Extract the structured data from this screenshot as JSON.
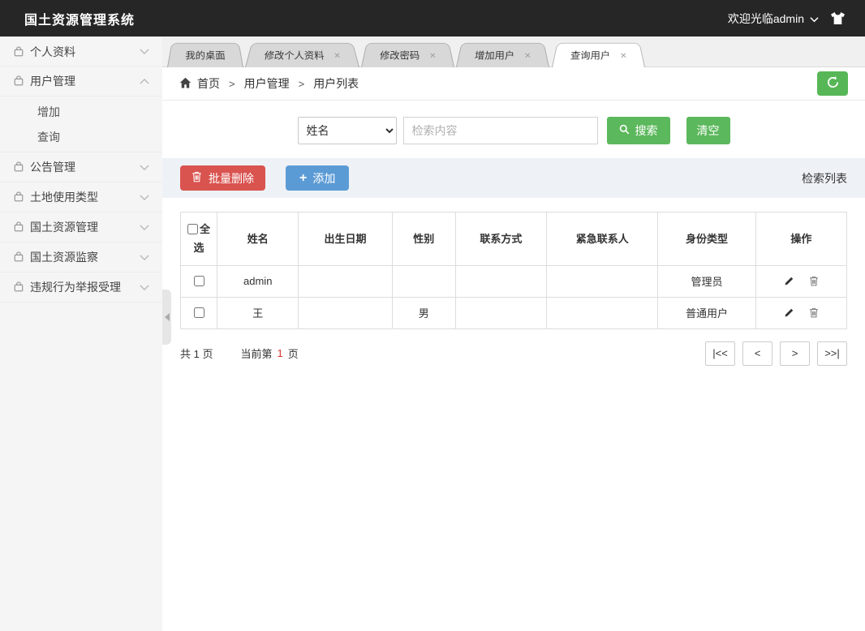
{
  "topbar": {
    "title": "国土资源管理系统",
    "welcome": "欢迎光临admin"
  },
  "icons": {
    "close": "×"
  },
  "sidebar": {
    "items": [
      {
        "label": "个人资料"
      },
      {
        "label": "用户管理",
        "children": [
          {
            "label": "增加"
          },
          {
            "label": "查询"
          }
        ]
      },
      {
        "label": "公告管理"
      },
      {
        "label": "土地使用类型"
      },
      {
        "label": "国土资源管理"
      },
      {
        "label": "国土资源监察"
      },
      {
        "label": "违规行为举报受理"
      }
    ]
  },
  "tabs": [
    {
      "label": "我的桌面",
      "closable": false,
      "active": false
    },
    {
      "label": "修改个人资料",
      "closable": true,
      "active": false
    },
    {
      "label": "修改密码",
      "closable": true,
      "active": false
    },
    {
      "label": "增加用户",
      "closable": true,
      "active": false
    },
    {
      "label": "查询用户",
      "closable": true,
      "active": true
    }
  ],
  "breadcrumb": {
    "home": "首页",
    "sep": ">",
    "level2": "用户管理",
    "level3": "用户列表"
  },
  "search": {
    "field_selected": "姓名",
    "placeholder": "检索内容",
    "search_label": "搜索",
    "clear_label": "清空"
  },
  "toolbar": {
    "batch_delete_label": "批量删除",
    "plus": "+",
    "add_label": "添加",
    "list_label": "检索列表"
  },
  "table": {
    "select_all_label": "全选",
    "headers": [
      "姓名",
      "出生日期",
      "性别",
      "联系方式",
      "紧急联系人",
      "身份类型",
      "操作"
    ],
    "rows": [
      {
        "name": "admin",
        "birth_date": "",
        "gender": "",
        "contact": "",
        "emergency_contact": "",
        "identity_type": "管理员"
      },
      {
        "name": "王",
        "birth_date": "",
        "gender": "男",
        "contact": "",
        "emergency_contact": "",
        "identity_type": "普通用户"
      }
    ]
  },
  "pagination": {
    "total_text": "共 1 页",
    "current_prefix": "当前第",
    "current_page": "1",
    "current_suffix": "页",
    "first_label": "|<<",
    "prev_label": "<",
    "next_label": ">",
    "last_label": ">>|"
  },
  "colors": {
    "topbar_bg": "#262626",
    "sidebar_bg": "#f5f5f5",
    "green": "#5cb85c",
    "red": "#d9534f",
    "blue": "#5b9bd5",
    "toolbar_bg": "#eef2f7",
    "current_page_red": "#d9342b"
  }
}
